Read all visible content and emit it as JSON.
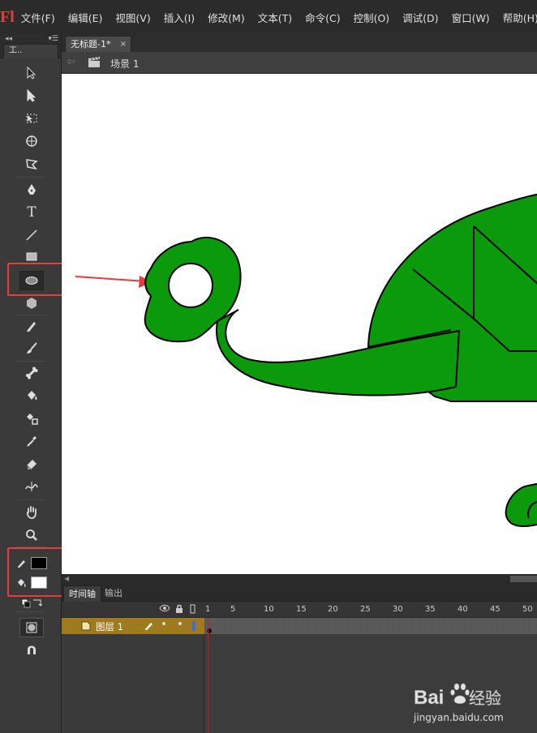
{
  "app": {
    "logo": "Fl",
    "menu": [
      "文件(F)",
      "编辑(E)",
      "视图(V)",
      "插入(I)",
      "修改(M)",
      "文本(T)",
      "命令(C)",
      "控制(O)",
      "调试(D)",
      "窗口(W)",
      "帮助(H)"
    ]
  },
  "toolbox": {
    "collapse_glyph": "◂◂",
    "tab_label": "工..",
    "menu_glyph": "▾☰",
    "tools": [
      {
        "name": "selection-tool",
        "icon": "arrow-icon"
      },
      {
        "name": "subselection-tool",
        "icon": "white-arrow-icon"
      },
      {
        "name": "free-transform-tool",
        "icon": "transform-icon"
      },
      {
        "name": "3d-rotation-tool",
        "icon": "3d-rotate-icon"
      },
      {
        "name": "lasso-tool",
        "icon": "lasso-icon"
      },
      {
        "name": "pen-tool",
        "icon": "pen-icon"
      },
      {
        "name": "text-tool",
        "icon": "text-icon",
        "glyph": "T"
      },
      {
        "name": "line-tool",
        "icon": "line-icon"
      },
      {
        "name": "rectangle-tool",
        "icon": "rectangle-icon"
      },
      {
        "name": "oval-tool",
        "icon": "oval-icon",
        "selected": true
      },
      {
        "name": "polystar-tool",
        "icon": "hexagon-icon"
      },
      {
        "name": "pencil-tool",
        "icon": "pencil-icon"
      },
      {
        "name": "brush-tool",
        "icon": "brush-icon"
      },
      {
        "name": "bone-tool",
        "icon": "bone-icon"
      },
      {
        "name": "paint-bucket-tool",
        "icon": "bucket-icon"
      },
      {
        "name": "ink-bottle-tool",
        "icon": "ink-bottle-icon"
      },
      {
        "name": "eyedropper-tool",
        "icon": "eyedropper-icon"
      },
      {
        "name": "eraser-tool",
        "icon": "eraser-icon"
      },
      {
        "name": "width-tool",
        "icon": "width-icon"
      },
      {
        "name": "hand-tool",
        "icon": "hand-icon"
      },
      {
        "name": "zoom-tool",
        "icon": "magnifier-icon"
      }
    ],
    "stroke_color": "#000000",
    "fill_color": "#ffffff",
    "highlight_color": "#e83b3b"
  },
  "document": {
    "tab_title": "无标题-1*",
    "tab_close": "×",
    "scene_label": "场景 1",
    "back_glyph": "⇦"
  },
  "stage": {
    "background": "#ffffff",
    "shape_fill": "#0b9a0b",
    "shape_stroke": "#000000",
    "arrow_color": "#e83b3b"
  },
  "timeline": {
    "tabs": [
      "时间轴",
      "输出"
    ],
    "header_icons": [
      "eye-icon",
      "lock-icon",
      "outline-icon"
    ],
    "frame_numbers": [
      "1",
      "5",
      "10",
      "15",
      "20",
      "25",
      "30",
      "35",
      "40",
      "45",
      "50"
    ],
    "layers": [
      {
        "name": "图层 1",
        "outline_color": "#3b6fd8"
      }
    ],
    "current_frame": 1
  },
  "watermark": {
    "brand": "Bai",
    "brand_suffix": "经验",
    "url": "jingyan.baidu.com"
  }
}
